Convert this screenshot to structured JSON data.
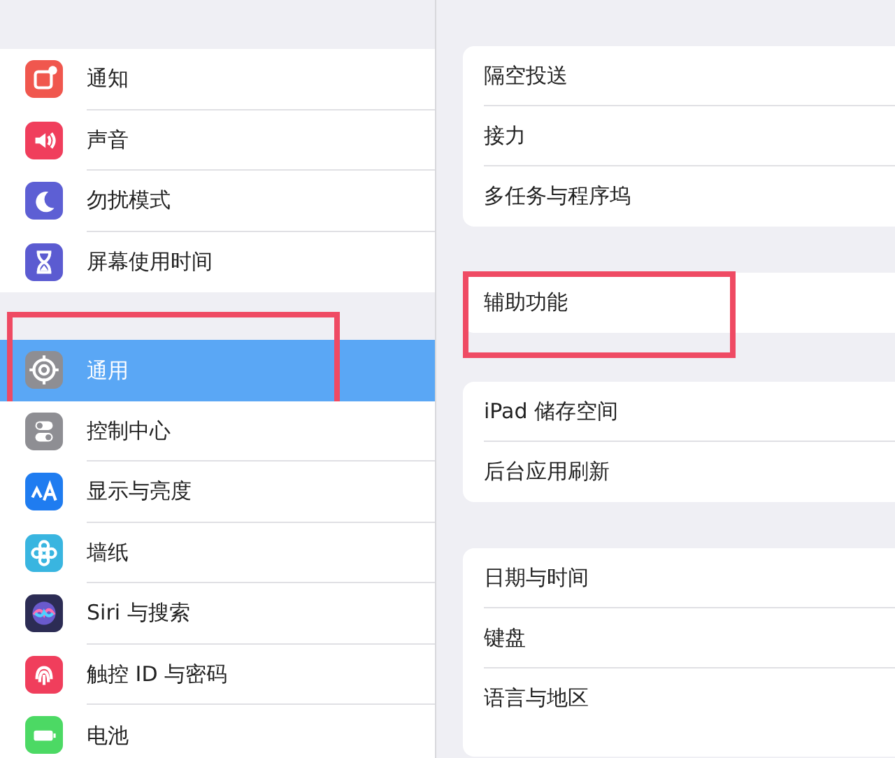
{
  "sidebar": {
    "groups": [
      {
        "items": [
          {
            "label": "通知",
            "kind": "notify",
            "color": "#f0574e",
            "selected": false,
            "highlighted": false
          },
          {
            "label": "声音",
            "kind": "sound",
            "color": "#f03e5c",
            "selected": false,
            "highlighted": false
          },
          {
            "label": "勿扰模式",
            "kind": "moon",
            "color": "#5d5fd4",
            "selected": false,
            "highlighted": false
          },
          {
            "label": "屏幕使用时间",
            "kind": "hourglass",
            "color": "#5b5bd1",
            "selected": false,
            "highlighted": false
          }
        ]
      },
      {
        "items": [
          {
            "label": "通用",
            "kind": "gear",
            "color": "#8e8e93",
            "selected": true,
            "highlighted": true
          },
          {
            "label": "控制中心",
            "kind": "toggles",
            "color": "#8e8e93",
            "selected": false,
            "highlighted": false
          },
          {
            "label": "显示与亮度",
            "kind": "text",
            "color": "#1f7cf0",
            "selected": false,
            "highlighted": false
          },
          {
            "label": "墙纸",
            "kind": "flower",
            "color": "#39b5e0",
            "selected": false,
            "highlighted": false
          },
          {
            "label": "Siri 与搜索",
            "kind": "siri",
            "color": "#2c2c54",
            "selected": false,
            "highlighted": false
          },
          {
            "label": "触控 ID 与密码",
            "kind": "fingerprint",
            "color": "#f03e5c",
            "selected": false,
            "highlighted": false
          },
          {
            "label": "电池",
            "kind": "battery",
            "color": "#4cd964",
            "selected": false,
            "highlighted": false
          }
        ]
      }
    ]
  },
  "detail": {
    "groups": [
      {
        "items": [
          {
            "label": "隔空投送",
            "highlighted": false
          },
          {
            "label": "接力",
            "highlighted": false
          },
          {
            "label": "多任务与程序坞",
            "highlighted": false
          }
        ]
      },
      {
        "items": [
          {
            "label": "辅助功能",
            "highlighted": true
          }
        ]
      },
      {
        "items": [
          {
            "label": "iPad 储存空间",
            "highlighted": false
          },
          {
            "label": "后台应用刷新",
            "highlighted": false
          }
        ]
      },
      {
        "items": [
          {
            "label": "日期与时间",
            "highlighted": false
          },
          {
            "label": "键盘",
            "highlighted": false
          },
          {
            "label": "语言与地区",
            "highlighted": false
          }
        ]
      }
    ]
  }
}
